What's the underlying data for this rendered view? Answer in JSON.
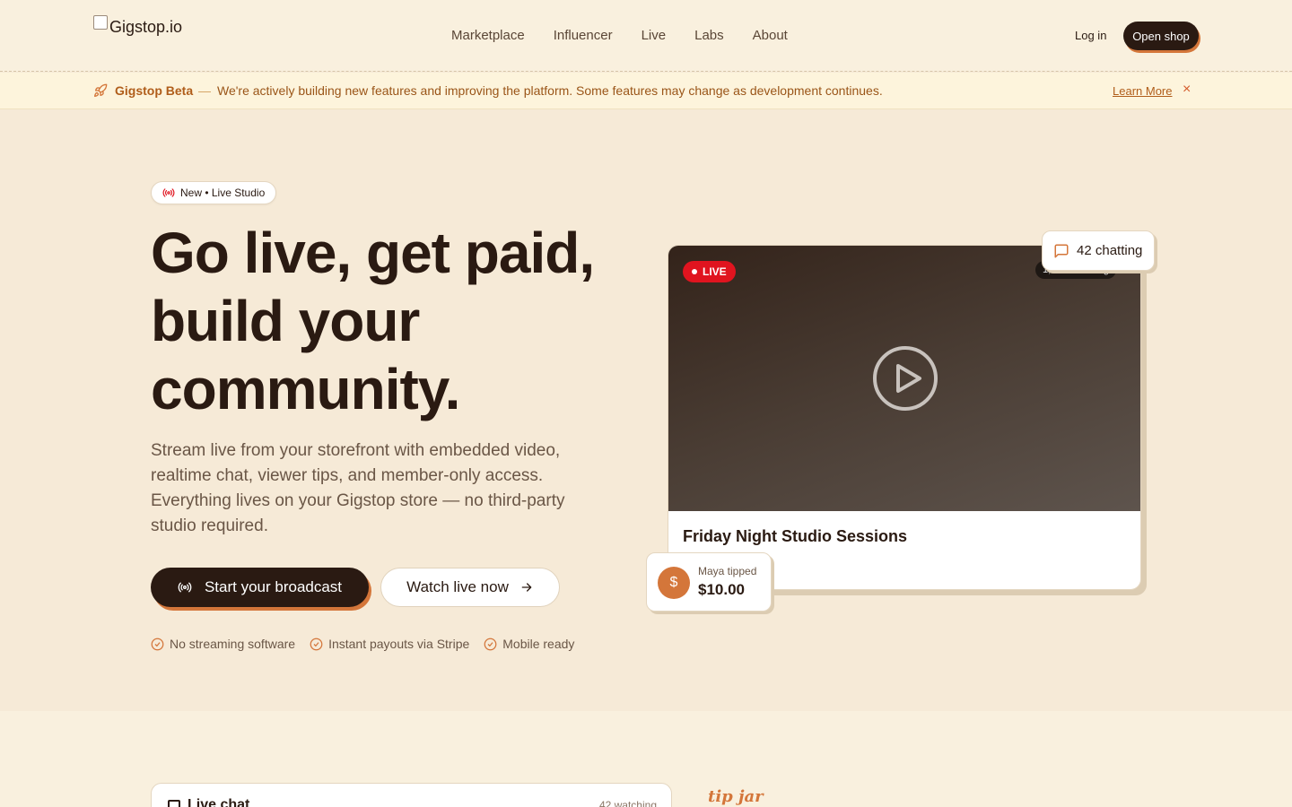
{
  "nav": {
    "logo_alt": "Gigstop.io",
    "links": [
      "Marketplace",
      "Influencer",
      "Live",
      "Labs",
      "About"
    ],
    "login": "Log in",
    "open_shop": "Open shop"
  },
  "banner": {
    "title": "Gigstop Beta",
    "dash": "—",
    "message": "We're actively building new features and improving the platform. Some features may change as development continues.",
    "learn_more": "Learn More",
    "close_icon": "×"
  },
  "hero": {
    "pill": "New • Live Studio",
    "headline_1": "Go live, get paid,",
    "headline_2": "build your",
    "headline_3": "community.",
    "subtitle": "Stream live from your storefront with embedded video, realtime chat, viewer tips, and member-only access. Everything lives on your Gigstop store — no third-party studio required.",
    "start_button": "Start your broadcast",
    "watch_button": "Watch live now",
    "features": [
      "No streaming software",
      "Instant payouts via Stripe",
      "Mobile ready"
    ]
  },
  "video_card": {
    "live_label": "LIVE",
    "watching": "1,284 watching",
    "title": "Friday Night Studio Sessions",
    "chatting": "42 chatting",
    "tip_name": "Maya tipped",
    "tip_amount": "$10.00",
    "tip_symbol": "$"
  },
  "lower": {
    "chat_title": "Live chat",
    "chat_watching": "42 watching",
    "tip_jar": "tip jar"
  },
  "colors": {
    "accent": "#d4763a",
    "dark": "#2a1a12",
    "live_red": "#e0141f",
    "background": "#f6ead7"
  }
}
